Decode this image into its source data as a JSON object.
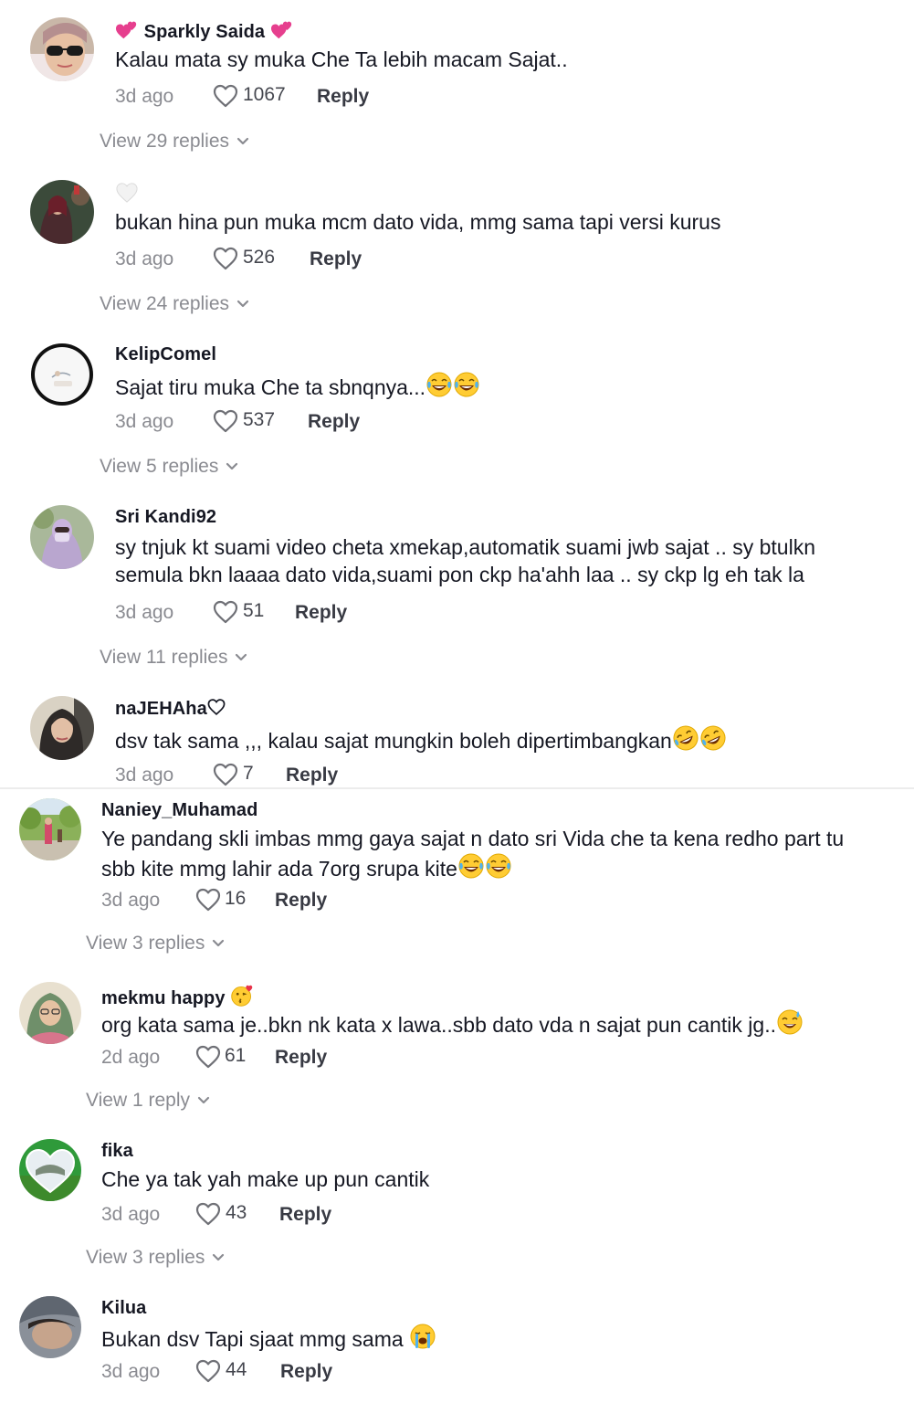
{
  "comments_top": [
    {
      "username": "Sparkly Saida",
      "text": "Kalau mata sy muka Che Ta lebih macam Sajat..",
      "time": "3d ago",
      "likes": "1067",
      "reply_label": "Reply",
      "view_replies": "View 29 replies"
    },
    {
      "username": "",
      "text": "bukan hina pun muka mcm dato vida, mmg sama tapi versi kurus",
      "time": "3d ago",
      "likes": "526",
      "reply_label": "Reply",
      "view_replies": "View 24 replies"
    },
    {
      "username": "KelipComel",
      "text": "Sajat tiru muka Che ta sbnqnya...",
      "time": "3d ago",
      "likes": "537",
      "reply_label": "Reply",
      "view_replies": "View 5 replies"
    },
    {
      "username": "Sri Kandi92",
      "text": "sy tnjuk kt suami video cheta xmekap,automatik suami jwb sajat .. sy btulkn semula bkn laaaa dato vida,suami pon ckp ha'ahh laa .. sy ckp lg eh tak la",
      "time": "3d ago",
      "likes": "51",
      "reply_label": "Reply",
      "view_replies": "View 11 replies"
    },
    {
      "username": "naJEHAha",
      "text": "dsv tak sama ,,, kalau sajat mungkin boleh dipertimbangkan",
      "time": "3d ago",
      "likes": "7",
      "reply_label": "Reply"
    }
  ],
  "comments_bottom": [
    {
      "username": "Naniey_Muhamad",
      "text": "Ye pandang skli imbas mmg gaya sajat n dato sri Vida che ta kena redho part tu sbb kite mmg lahir ada 7org srupa kite",
      "time": "3d ago",
      "likes": "16",
      "reply_label": "Reply",
      "view_replies": "View 3 replies"
    },
    {
      "username": "mekmu happy",
      "text": "org kata sama je..bkn nk kata x lawa..sbb dato vda n sajat pun cantik jg..",
      "time": "2d ago",
      "likes": "61",
      "reply_label": "Reply",
      "view_replies": "View 1 reply"
    },
    {
      "username": "fika",
      "text": "Che ya tak yah make up pun cantik",
      "time": "3d ago",
      "likes": "43",
      "reply_label": "Reply",
      "view_replies": "View 3 replies"
    },
    {
      "username": "Kilua",
      "text": "Bukan dsv Tapi sjaat mmg sama",
      "time": "3d ago",
      "likes": "44",
      "reply_label": "Reply"
    }
  ],
  "icons": {
    "like": "heart-outline-icon",
    "chevron": "chevron-down-icon",
    "emojis": [
      "two-hearts-emoji",
      "white-heart-emoji",
      "tears-of-joy-emoji",
      "rofl-emoji",
      "kissing-heart-emoji",
      "sweat-smile-emoji",
      "loudly-crying-emoji"
    ]
  },
  "colors": {
    "text": "#161823",
    "muted": "#8a8b91",
    "background": "#ffffff"
  }
}
